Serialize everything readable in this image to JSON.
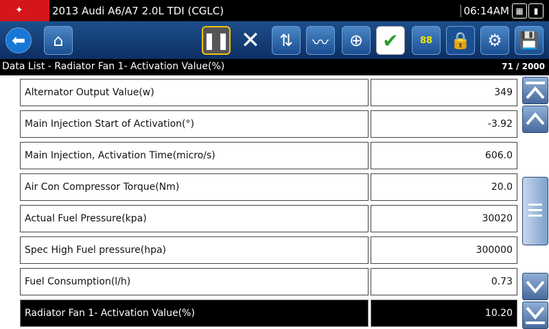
{
  "title": "2013 Audi A6/A7 2.0L TDI (CGLC)",
  "clock": "06:14AM",
  "breadcrumb": "Data List - Radiator Fan 1- Activation Value(%)",
  "counter": "71 / 2000",
  "toolbar": {
    "speed_label": "88"
  },
  "rows": [
    {
      "name": "Alternator Output Value(w)",
      "value": "349"
    },
    {
      "name": "Main Injection Start of Activation(°)",
      "value": "-3.92"
    },
    {
      "name": "Main Injection, Activation Time(micro/s)",
      "value": "606.0"
    },
    {
      "name": "Air Con Compressor Torque(Nm)",
      "value": "20.0"
    },
    {
      "name": "Actual Fuel Pressure(kpa)",
      "value": "30020"
    },
    {
      "name": "Spec High Fuel pressure(hpa)",
      "value": "300000"
    },
    {
      "name": "Fuel Consumption(l/h)",
      "value": "0.73"
    },
    {
      "name": "Radiator Fan 1- Activation Value(%)",
      "value": "10.20"
    }
  ],
  "colors": {
    "brand": "#d4161c",
    "toolbar": "#1d4f8c",
    "selected": "#000000"
  }
}
